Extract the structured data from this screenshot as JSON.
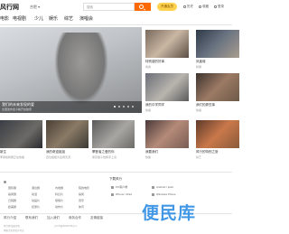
{
  "header": {
    "logo": "风行网",
    "location": "合肥",
    "search_placeholder": "搜索",
    "vip_label": "开通会员",
    "links": [
      "历史",
      "收藏",
      "登录"
    ]
  },
  "nav": {
    "items": [
      "电影",
      "电视剧",
      "少儿",
      "娱乐",
      "综艺",
      "演唱会"
    ]
  },
  "banner": {
    "title": "我们的未来发现的爱",
    "subtitle": "全国发布会今晚开启独家",
    "dots": 5
  },
  "cards_left": [
    {
      "title": "新生",
      "sub": "李易峰新剧正在热播"
    },
    {
      "title": "我的奇迹姐姐",
      "sub": "四位姐姐为爱闯天涯"
    },
    {
      "title": "攀登者之爱的你",
      "sub": "吴京章子怡携手上演"
    }
  ],
  "cards_right": [
    {
      "title": "特别感的好事",
      "sub": "青春"
    },
    {
      "title": "凤凰城",
      "sub": "新剧"
    },
    {
      "title": "我的中学同学",
      "sub": "热播"
    },
    {
      "title": "我们的那些事",
      "sub": "热播"
    },
    {
      "title": "我要我们",
      "sub": "热播"
    },
    {
      "title": "风行的特别之旅",
      "sub": "综艺"
    },
    {
      "title": "我的奇迹特别",
      "sub": "青春"
    },
    {
      "title": "我们的秘密",
      "sub": "热播"
    }
  ],
  "footer_links_col": [
    [
      "国际服",
      "港台剧",
      "内地剧",
      "院线电影"
    ],
    [
      "搞笑剧",
      "动漫",
      "科幻片",
      "搞笑"
    ],
    [
      "日韩剧",
      "动画片",
      "惊悚片",
      "音乐"
    ],
    [
      "欧美剧",
      "纪录片",
      "动作片",
      "体育"
    ],
    [
      "泰剧",
      "少儿",
      "恐怖片",
      "游戏"
    ]
  ],
  "download": {
    "title": "下载风行",
    "items": [
      "PC客户端",
      "Android / Ipad",
      "iPhone / iPad",
      "Windows Phone"
    ]
  },
  "footer": {
    "links": [
      "风行介绍",
      "联系我们",
      "加入我们",
      "商务合作",
      "友情链接"
    ],
    "copyright": "风行网 版权所有",
    "license": "沪ICP备08005795号-2",
    "misc": "网络文化经营许可证"
  },
  "watermark": "便民库",
  "colors": {
    "accent": "#ff6a00",
    "vip": "#ffd24d",
    "watermark": "#2f8de4"
  }
}
